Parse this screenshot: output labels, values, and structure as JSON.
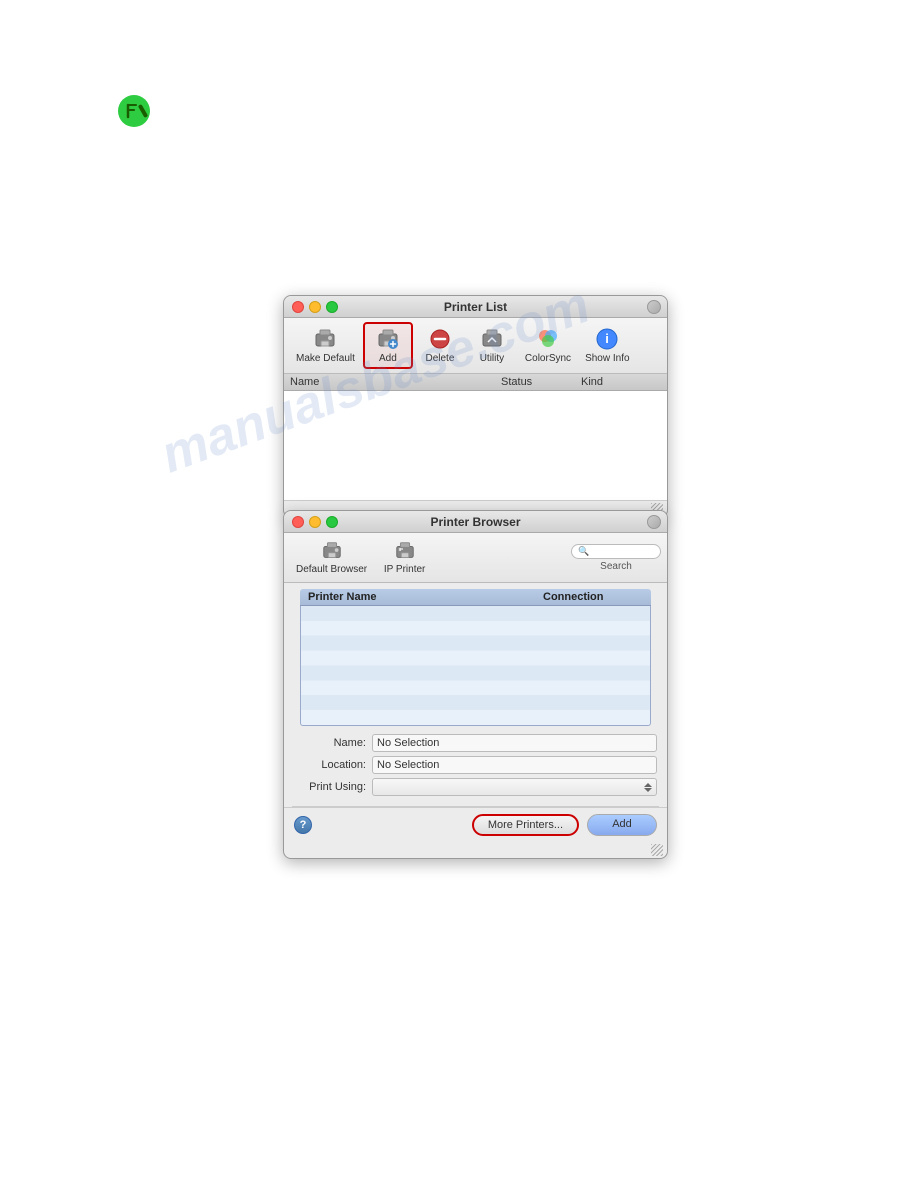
{
  "page": {
    "background": "#ffffff",
    "watermark": "manualsbase.com"
  },
  "green_icon": {
    "title": "note-icon"
  },
  "printer_list_window": {
    "title": "Printer List",
    "toolbar": {
      "buttons": [
        {
          "id": "make-default",
          "label": "Make Default",
          "icon": "printer-icon"
        },
        {
          "id": "add",
          "label": "Add",
          "icon": "add-printer-icon",
          "highlighted": true
        },
        {
          "id": "delete",
          "label": "Delete",
          "icon": "delete-icon"
        },
        {
          "id": "utility",
          "label": "Utility",
          "icon": "utility-icon"
        },
        {
          "id": "colorsync",
          "label": "ColorSync",
          "icon": "colorsync-icon"
        },
        {
          "id": "show-info",
          "label": "Show Info",
          "icon": "info-icon"
        }
      ]
    },
    "table": {
      "columns": [
        "Name",
        "Status",
        "Kind"
      ],
      "rows": []
    }
  },
  "printer_browser_window": {
    "title": "Printer Browser",
    "toolbar": {
      "buttons": [
        {
          "id": "default-browser",
          "label": "Default Browser",
          "icon": "default-browser-icon"
        },
        {
          "id": "ip-printer",
          "label": "IP Printer",
          "icon": "ip-printer-icon"
        }
      ],
      "search_placeholder": "Search"
    },
    "table": {
      "columns": [
        {
          "id": "printer-name",
          "label": "Printer Name"
        },
        {
          "id": "connection",
          "label": "Connection"
        }
      ],
      "rows": []
    },
    "form": {
      "name_label": "Name:",
      "name_value": "No Selection",
      "location_label": "Location:",
      "location_value": "No Selection",
      "print_using_label": "Print Using:",
      "print_using_value": ""
    },
    "buttons": {
      "help_label": "?",
      "more_printers_label": "More Printers...",
      "add_label": "Add"
    }
  }
}
